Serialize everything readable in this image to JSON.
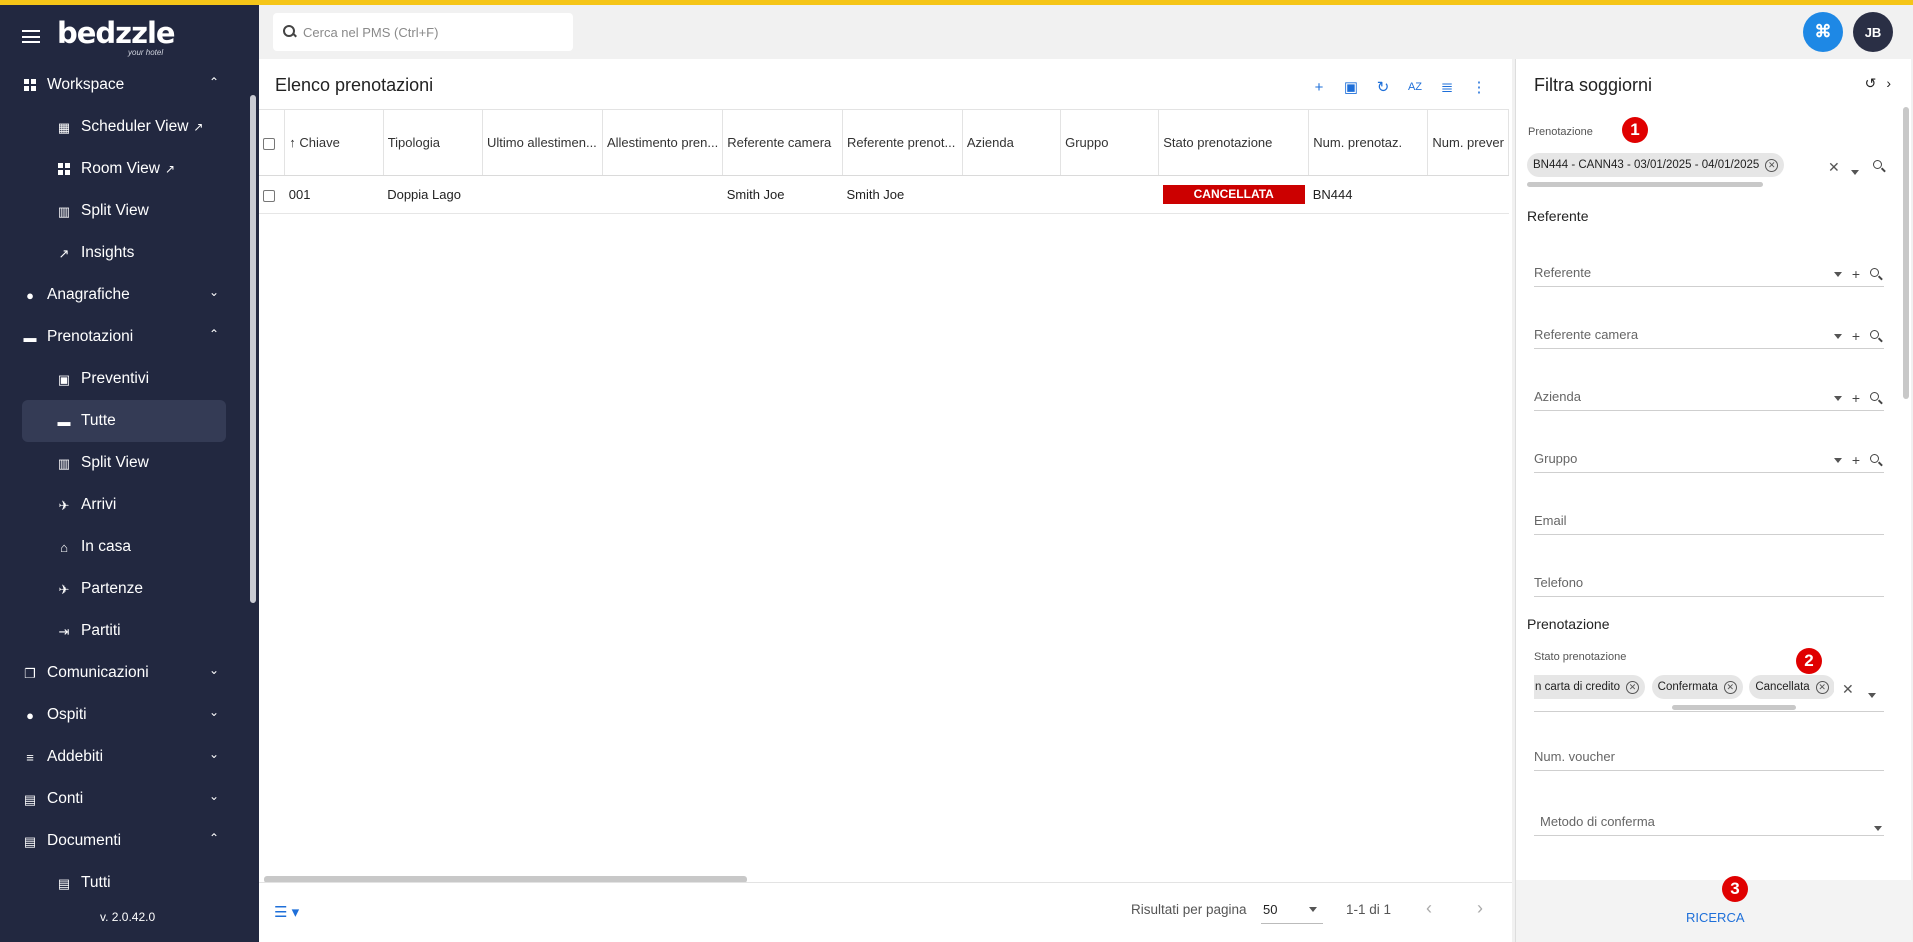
{
  "app": {
    "logo": "bedzzle",
    "logo_sub": "your hotel",
    "version": "v. 2.0.42.0"
  },
  "search": {
    "placeholder": "Cerca nel PMS (Ctrl+F)"
  },
  "user": {
    "initials": "JB"
  },
  "sidebar": {
    "items": [
      {
        "label": "Workspace",
        "icon": "dashboard-icon",
        "chevron": "up"
      },
      {
        "label": "Scheduler View",
        "icon": "calendar-icon",
        "external": true
      },
      {
        "label": "Room View",
        "icon": "grid-icon",
        "external": true
      },
      {
        "label": "Split View",
        "icon": "split-icon"
      },
      {
        "label": "Insights",
        "icon": "trend-icon"
      },
      {
        "label": "Anagrafiche",
        "icon": "person-icon",
        "chevron": "down"
      },
      {
        "label": "Prenotazioni",
        "icon": "bed-icon",
        "chevron": "up"
      },
      {
        "label": "Preventivi",
        "icon": "luggage-icon"
      },
      {
        "label": "Tutte",
        "icon": "bed-icon",
        "active": true
      },
      {
        "label": "Split View",
        "icon": "split-icon"
      },
      {
        "label": "Arrivi",
        "icon": "plane-land-icon"
      },
      {
        "label": "In casa",
        "icon": "home-icon"
      },
      {
        "label": "Partenze",
        "icon": "plane-takeoff-icon"
      },
      {
        "label": "Partiti",
        "icon": "logout-icon"
      },
      {
        "label": "Comunicazioni",
        "icon": "copy-icon",
        "chevron": "down"
      },
      {
        "label": "Ospiti",
        "icon": "person-check-icon",
        "chevron": "down"
      },
      {
        "label": "Addebiti",
        "icon": "list-icon",
        "chevron": "down"
      },
      {
        "label": "Conti",
        "icon": "receipt-icon",
        "chevron": "down"
      },
      {
        "label": "Documenti",
        "icon": "book-icon",
        "chevron": "up"
      },
      {
        "label": "Tutti",
        "icon": "book-icon"
      }
    ]
  },
  "main": {
    "title": "Elenco prenotazioni",
    "columns": [
      "Chiave",
      "Tipologia",
      "Ultimo allestimen...",
      "Allestimento pren...",
      "Referente camera",
      "Referente prenot...",
      "Azienda",
      "Gruppo",
      "Stato prenotazione",
      "Num. prenotaz.",
      "Num. prever"
    ],
    "rows": [
      {
        "chiave": "001",
        "tipologia": "Doppia Lago",
        "ultimo": "",
        "allestimento": "",
        "ref_camera": "Smith Joe",
        "ref_pren": "Smith Joe",
        "azienda": "",
        "gruppo": "",
        "stato": "CANCELLATA",
        "num_pren": "BN444",
        "num_prev": ""
      }
    ],
    "footer": {
      "rpp_label": "Risultati per pagina",
      "rpp_value": "50",
      "range": "1-1 di 1"
    }
  },
  "filter": {
    "title": "Filtra soggiorni",
    "prenotazione_label": "Prenotazione",
    "prenotazione_chip": "BN444 - CANN43 - 03/01/2025 - 04/01/2025",
    "referente_section": "Referente",
    "fields": {
      "referente": "Referente",
      "referente_camera": "Referente camera",
      "azienda": "Azienda",
      "gruppo": "Gruppo",
      "email": "Email",
      "telefono": "Telefono"
    },
    "prenotazione_section": "Prenotazione",
    "stato_label": "Stato prenotazione",
    "stato_chips": [
      "n carta di credito",
      "Confermata",
      "Cancellata"
    ],
    "num_voucher": "Num. voucher",
    "metodo_conferma": "Metodo di conferma",
    "search_button": "RICERCA"
  },
  "markers": [
    "1",
    "2",
    "3"
  ],
  "colors": {
    "accent_yellow": "#f5c518",
    "sidebar_bg": "#222840",
    "primary_blue": "#1e6fd9",
    "status_red": "#cc0000",
    "marker_red": "#e00000"
  }
}
